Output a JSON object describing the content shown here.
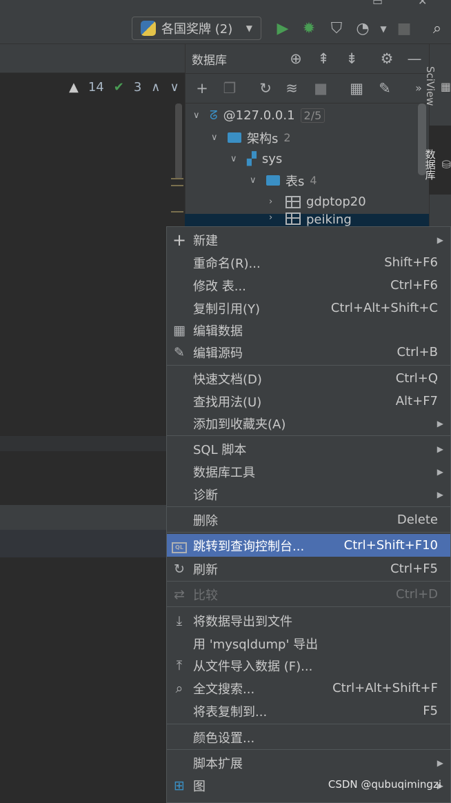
{
  "toolbar": {
    "run_config": "各国奖牌 (2)"
  },
  "editor": {
    "warnings": "14",
    "checks": "3"
  },
  "db_panel": {
    "title": "数据库",
    "tree": [
      {
        "label": "@127.0.0.1",
        "badge": "2/5"
      },
      {
        "label": "架构s",
        "count": "2"
      },
      {
        "label": "sys"
      },
      {
        "label": "表s",
        "count": "4"
      },
      {
        "label": "gdptop20"
      },
      {
        "label": "peiking"
      }
    ]
  },
  "right_strip": {
    "sciview": "SciView",
    "database": "数据库"
  },
  "menu": {
    "items": [
      {
        "label": "新建",
        "shortcut": "",
        "icon": "plus-icon",
        "submenu": true
      },
      {
        "label": "重命名(R)...",
        "shortcut": "Shift+F6"
      },
      {
        "label": "修改 表...",
        "shortcut": "Ctrl+F6"
      },
      {
        "label": "复制引用(Y)",
        "shortcut": "Ctrl+Alt+Shift+C"
      },
      {
        "label": "编辑数据",
        "shortcut": "",
        "icon": "table-icon"
      },
      {
        "label": "编辑源码",
        "shortcut": "Ctrl+B",
        "icon": "pencil-icon"
      },
      {
        "label": "快速文档(D)",
        "shortcut": "Ctrl+Q"
      },
      {
        "label": "查找用法(U)",
        "shortcut": "Alt+F7"
      },
      {
        "label": "添加到收藏夹(A)",
        "shortcut": "",
        "submenu": true
      },
      {
        "label": "SQL 脚本",
        "shortcut": "",
        "submenu": true
      },
      {
        "label": "数据库工具",
        "shortcut": "",
        "submenu": true
      },
      {
        "label": "诊断",
        "shortcut": "",
        "submenu": true
      },
      {
        "label": "删除",
        "shortcut": "Delete"
      },
      {
        "label": "跳转到查询控制台...",
        "shortcut": "Ctrl+Shift+F10",
        "icon": "console-icon"
      },
      {
        "label": "刷新",
        "shortcut": "Ctrl+F5",
        "icon": "refresh-icon"
      },
      {
        "label": "比较",
        "shortcut": "Ctrl+D",
        "icon": "compare-icon"
      },
      {
        "label": "将数据导出到文件",
        "shortcut": "",
        "icon": "export-icon"
      },
      {
        "label": "用 'mysqldump' 导出",
        "shortcut": ""
      },
      {
        "label": "从文件导入数据 (F)...",
        "shortcut": "",
        "icon": "import-icon"
      },
      {
        "label": "全文搜索...",
        "shortcut": "Ctrl+Alt+Shift+F",
        "icon": "search-icon"
      },
      {
        "label": "将表复制到...",
        "shortcut": "F5"
      },
      {
        "label": "颜色设置...",
        "shortcut": ""
      },
      {
        "label": "脚本扩展",
        "shortcut": "",
        "submenu": true
      },
      {
        "label": "图",
        "shortcut": "",
        "icon": "diagram-icon",
        "submenu": true
      }
    ]
  },
  "watermark": "CSDN @qubuqimingzi"
}
